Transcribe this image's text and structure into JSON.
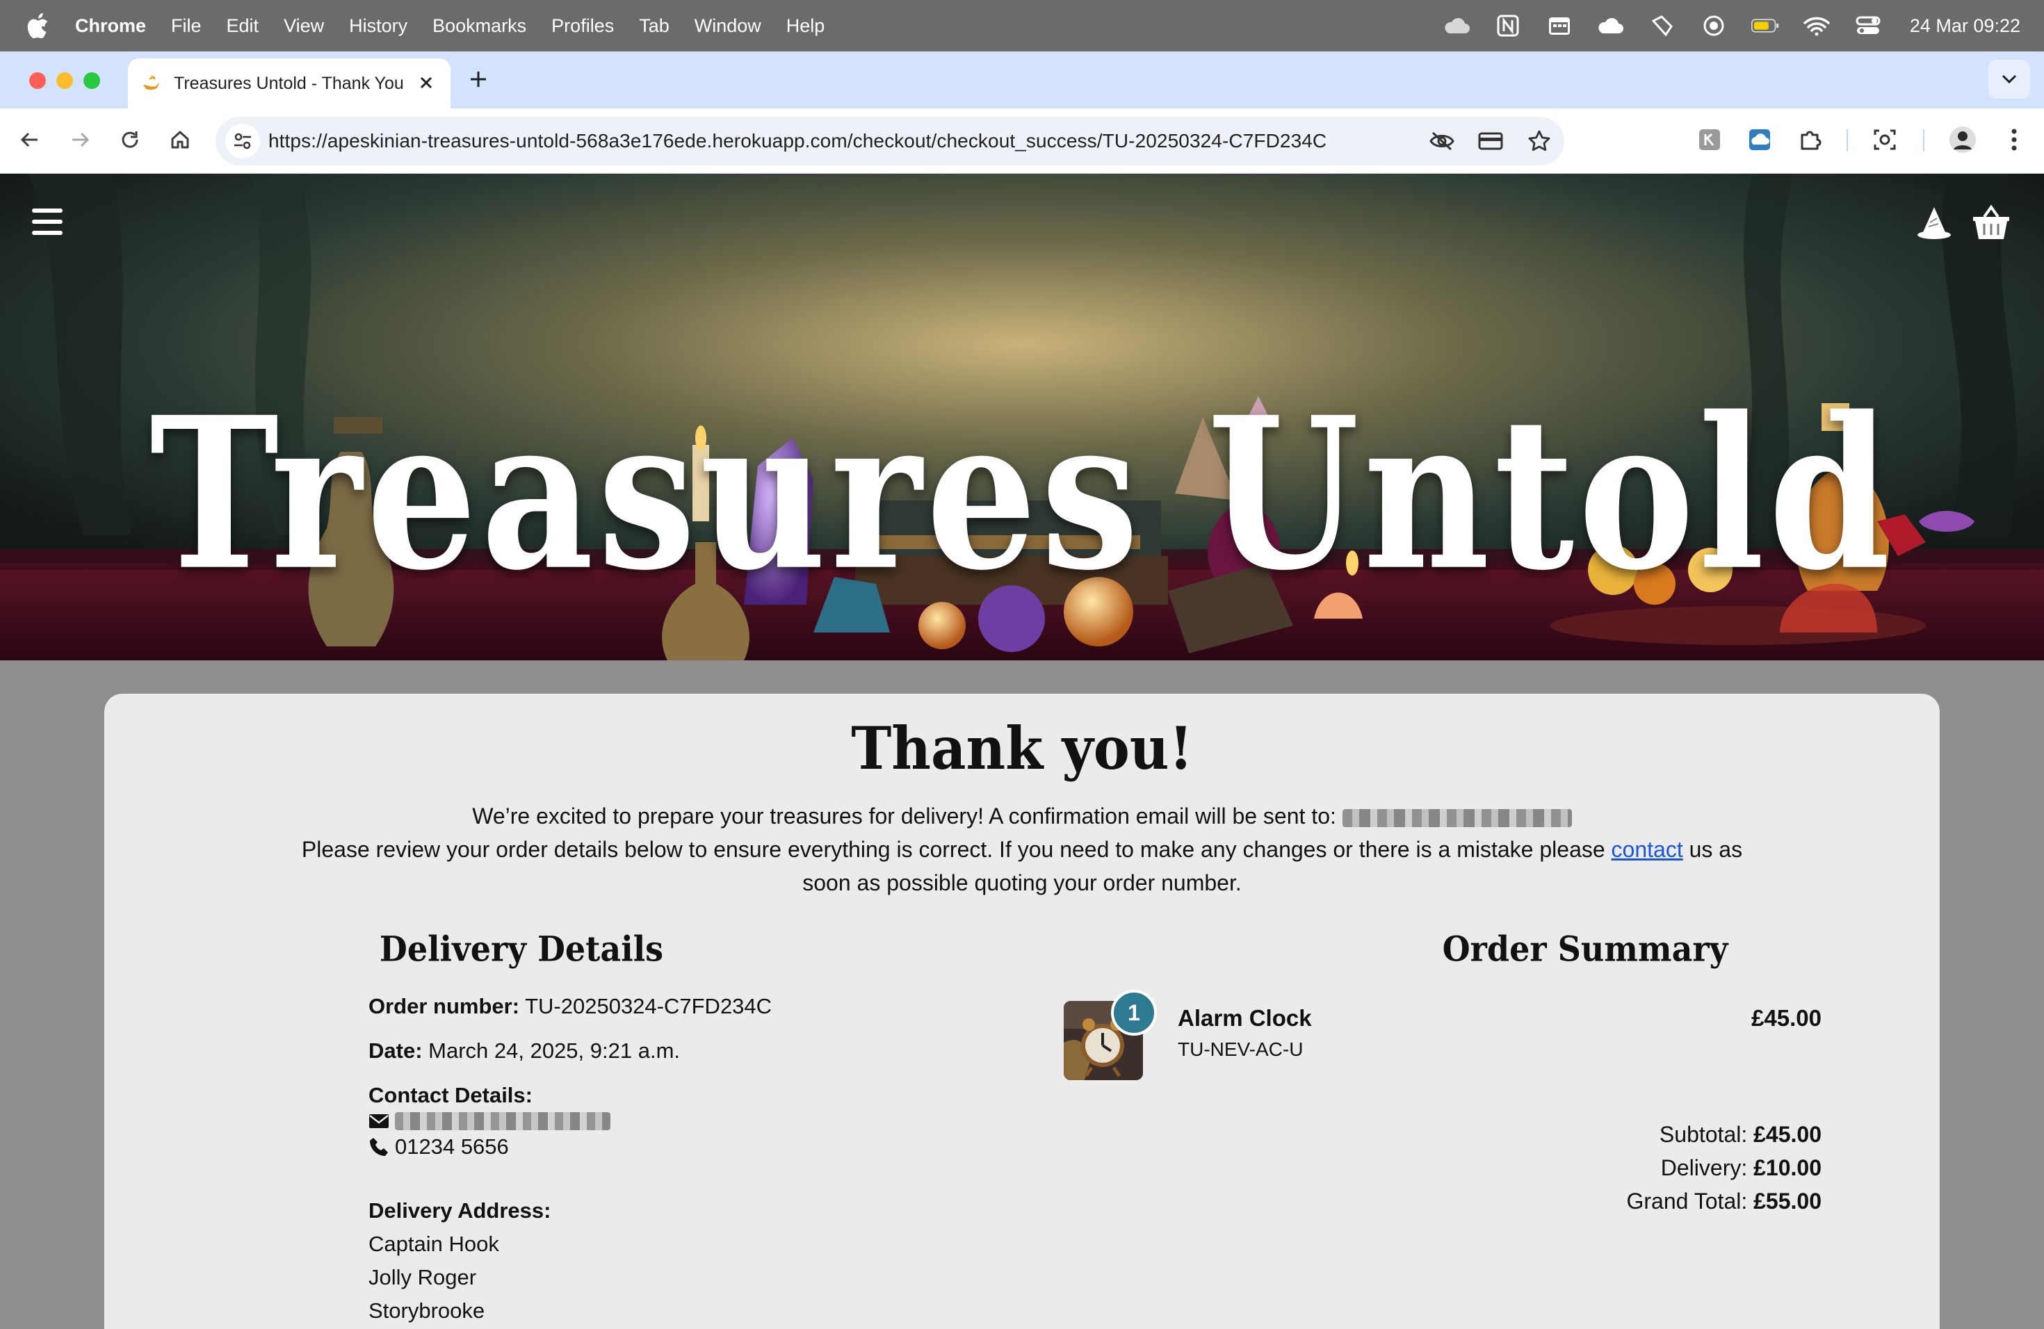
{
  "menubar": {
    "app_name": "Chrome",
    "menus": [
      "File",
      "Edit",
      "View",
      "History",
      "Bookmarks",
      "Profiles",
      "Tab",
      "Window",
      "Help"
    ],
    "status_icons": [
      "cloud-icon",
      "notion-icon",
      "calendar-icon",
      "cloud-sync-icon",
      "flashlight-icon",
      "focus-icon",
      "battery-icon",
      "wifi-icon",
      "control-center-icon"
    ],
    "clock": "24 Mar  09:22"
  },
  "browser": {
    "tab_title": "Treasures Untold - Thank You",
    "url": "https://apeskinian-treasures-untold-568a3e176ede.herokuapp.com/checkout/checkout_success/TU-20250324-C7FD234C"
  },
  "site": {
    "brand": "Treasures Untold"
  },
  "confirmation": {
    "heading": "Thank you!",
    "intro_line1": "We’re excited to prepare your treasures for delivery! A confirmation email will be sent to:",
    "intro_line2_pre": "Please review your order details below to ensure everything is correct. If you need to make any changes or there is a mistake please",
    "contact_link": "contact",
    "intro_line2_post": "us as",
    "intro_line3": "soon as possible quoting your order number."
  },
  "delivery": {
    "title": "Delivery Details",
    "order_number_label": "Order number:",
    "order_number": "TU-20250324-C7FD234C",
    "date_label": "Date:",
    "date": "March 24, 2025, 9:21 a.m.",
    "contact_label": "Contact Details:",
    "phone": "01234 5656",
    "address_label": "Delivery Address:",
    "address": [
      "Captain Hook",
      "Jolly Roger",
      "Storybrooke"
    ]
  },
  "summary": {
    "title": "Order Summary",
    "items": [
      {
        "quantity": "1",
        "name": "Alarm Clock",
        "sku": "TU-NEV-AC-U",
        "price": "£45.00"
      }
    ],
    "subtotal_label": "Subtotal:",
    "subtotal": "£45.00",
    "delivery_label": "Delivery:",
    "delivery": "£10.00",
    "grand_total_label": "Grand Total:",
    "grand_total": "£55.00"
  },
  "colors": {
    "link": "#1a55d6",
    "badge": "#2e7b91",
    "card": "#ebebeb",
    "tabstrip": "#d3e3fd"
  }
}
